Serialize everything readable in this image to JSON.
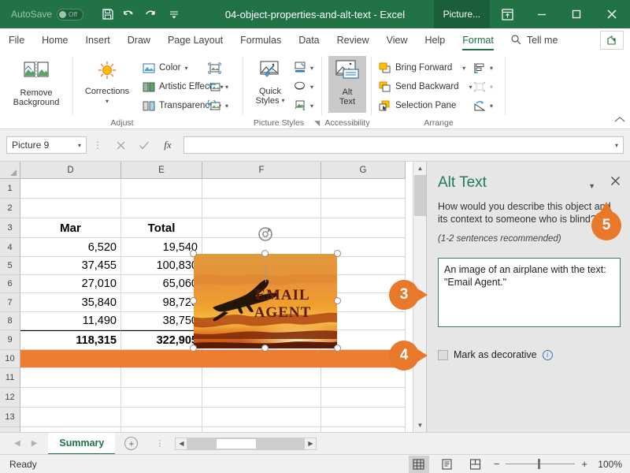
{
  "titlebar": {
    "autosave_label": "AutoSave",
    "autosave_state": "Off",
    "document_title": "04-object-properties-and-alt-text  -  Excel",
    "contextual_tab": "Picture...",
    "buttons": {
      "save": "Save",
      "undo": "Undo",
      "redo": "Redo",
      "customize": "Customize Quick Access Toolbar",
      "ribbon_display": "Ribbon Display Options",
      "minimize": "Minimize",
      "maximize": "Maximize",
      "close": "Close"
    }
  },
  "tabs": [
    {
      "label": "File",
      "active": false
    },
    {
      "label": "Home",
      "active": false
    },
    {
      "label": "Insert",
      "active": false
    },
    {
      "label": "Draw",
      "active": false
    },
    {
      "label": "Page Layout",
      "active": false
    },
    {
      "label": "Formulas",
      "active": false
    },
    {
      "label": "Data",
      "active": false
    },
    {
      "label": "Review",
      "active": false
    },
    {
      "label": "View",
      "active": false
    },
    {
      "label": "Help",
      "active": false
    },
    {
      "label": "Format",
      "active": true
    }
  ],
  "tellme": {
    "label": "Tell me",
    "share": "Share"
  },
  "ribbon": {
    "groups": [
      {
        "name": "Adjust"
      },
      {
        "name": "Picture Styles"
      },
      {
        "name": "Accessibility"
      },
      {
        "name": "Arrange"
      }
    ],
    "remove_background": "Remove\nBackground",
    "remove_background_line1": "Remove",
    "remove_background_line2": "Background",
    "corrections": "Corrections",
    "color": "Color",
    "artistic_effects": "Artistic Effects",
    "transparency": "Transparency",
    "quick_styles_line1": "Quick",
    "quick_styles_line2": "Styles",
    "alt_text_line1": "Alt",
    "alt_text_line2": "Text",
    "bring_forward": "Bring Forward",
    "send_backward": "Send Backward",
    "selection_pane": "Selection Pane",
    "dialog_launcher": "Dialog Box Launcher",
    "collapse_ribbon": "Collapse the Ribbon"
  },
  "formulabar": {
    "name_box_value": "Picture 9",
    "cancel": "Cancel",
    "enter": "Enter",
    "insert_function": "fx",
    "formula_value": "",
    "expand": "Expand Formula Bar"
  },
  "grid": {
    "columns": [
      "D",
      "E",
      "F",
      "G"
    ],
    "rows": [
      "1",
      "2",
      "3",
      "4",
      "5",
      "6",
      "7",
      "8",
      "9",
      "10",
      "11",
      "12",
      "13"
    ],
    "cells": {
      "3": {
        "D": "Mar",
        "E": "Total"
      },
      "4": {
        "D": "6,520",
        "E": "19,540"
      },
      "5": {
        "D": "37,455",
        "E": "100,830"
      },
      "6": {
        "D": "27,010",
        "E": "65,060"
      },
      "7": {
        "D": "35,840",
        "E": "98,725"
      },
      "8": {
        "D": "11,490",
        "E": "38,750"
      },
      "9": {
        "D": "118,315",
        "E": "322,905"
      }
    },
    "accent_row_color": "#ED7D31"
  },
  "picture": {
    "name": "Picture 9",
    "overlay_line1": "EMAIL",
    "overlay_line2": "AGENT",
    "rotate_handle": "Rotate"
  },
  "pane": {
    "title": "Alt Text",
    "dropdown": "Task Pane Options",
    "close": "Close",
    "question": "How would you describe this object and its context to someone who is blind?",
    "hint": "(1-2 sentences recommended)",
    "alt_text_value": "An image of an airplane with the text: \"Email Agent.\"",
    "mark_decorative_label": "Mark as decorative",
    "info": "More info",
    "title_color": "#1e7b5e"
  },
  "sheetbar": {
    "prev": "Previous Sheet",
    "next": "Next Sheet",
    "sheets": [
      "Summary"
    ],
    "active_sheet": "Summary",
    "new_sheet": "New sheet"
  },
  "statusbar": {
    "status": "Ready",
    "views": [
      "Normal",
      "Page Layout",
      "Page Break Preview"
    ],
    "zoom_out": "Zoom Out",
    "zoom_in": "Zoom In",
    "zoom_value": "100%"
  },
  "callouts": [
    {
      "number": "3",
      "direction": "right"
    },
    {
      "number": "4",
      "direction": "right"
    },
    {
      "number": "5",
      "direction": "up"
    }
  ]
}
